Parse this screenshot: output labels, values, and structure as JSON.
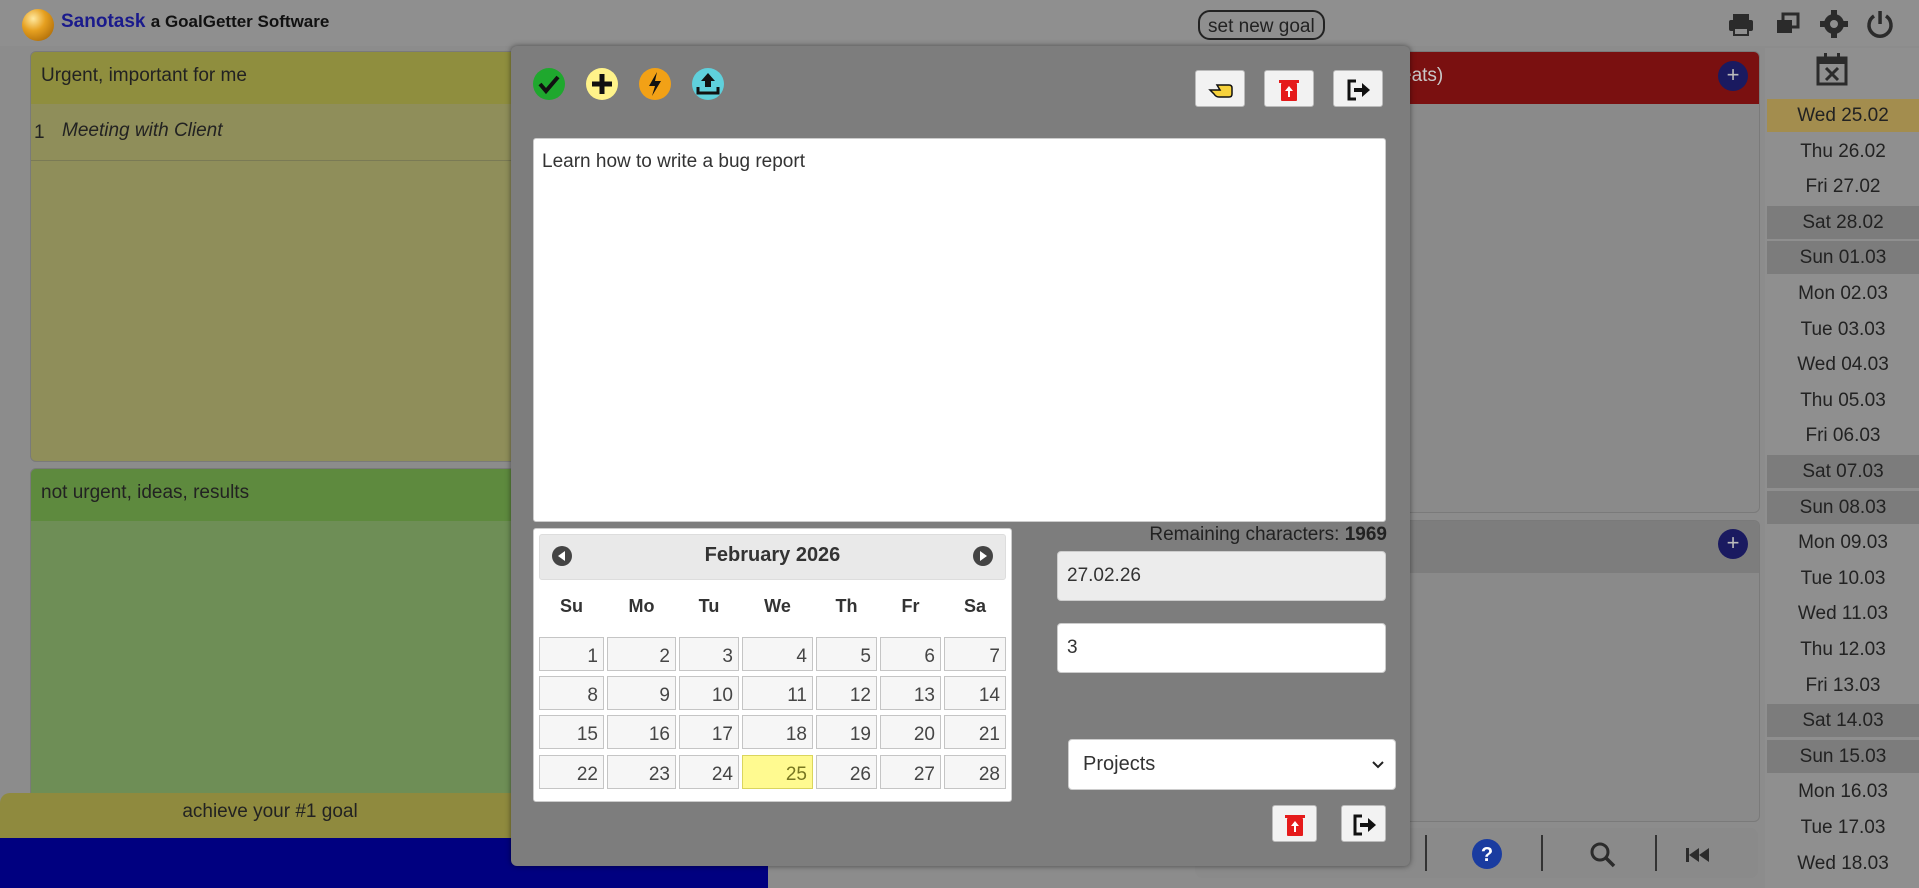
{
  "header": {
    "brand_name": "Sanotask",
    "brand_suffix": "a GoalGetter Software",
    "set_goal_label": "set new goal",
    "icons": [
      "print-icon",
      "windows-icon",
      "gear-icon",
      "power-icon"
    ]
  },
  "quadrants": {
    "urgent_important": {
      "title": "Urgent, important for me",
      "rows": [
        {
          "number": "1",
          "text": "Meeting with Client"
        }
      ]
    },
    "not_urgent": {
      "title": "not urgent, ideas, results"
    },
    "urgent_other": {
      "title_visible": "eats)"
    }
  },
  "bottom": {
    "goal_bar_label": "achieve your #1 goal"
  },
  "dates": [
    "Wed 25.02",
    "Thu 26.02",
    "Fri 27.02",
    "Sat 28.02",
    "Sun 01.03",
    "Mon 02.03",
    "Tue 03.03",
    "Wed 04.03",
    "Thu 05.03",
    "Fri 06.03",
    "Sat 07.03",
    "Sun 08.03",
    "Mon 09.03",
    "Tue 10.03",
    "Wed 11.03",
    "Thu 12.03",
    "Fri 13.03",
    "Sat 14.03",
    "Sun 15.03",
    "Mon 16.03",
    "Tue 17.03",
    "Wed 18.03"
  ],
  "modal": {
    "task_text": "Learn how to write a bug report",
    "remaining_label": "Remaining characters:",
    "remaining_count": "1969",
    "date_value": "27.02.26",
    "number_value": "3",
    "category_selected": "Projects",
    "calendar": {
      "month_title": "February 2026",
      "weekdays": [
        "Su",
        "Mo",
        "Tu",
        "We",
        "Th",
        "Fr",
        "Sa"
      ],
      "weeks": [
        [
          "1",
          "2",
          "3",
          "4",
          "5",
          "6",
          "7"
        ],
        [
          "8",
          "9",
          "10",
          "11",
          "12",
          "13",
          "14"
        ],
        [
          "15",
          "16",
          "17",
          "18",
          "19",
          "20",
          "21"
        ],
        [
          "22",
          "23",
          "24",
          "25",
          "26",
          "27",
          "28"
        ]
      ],
      "today": "25"
    }
  },
  "colors": {
    "brand_blue": "#1a1a8c",
    "today_highlight": "#fffa90",
    "urgent_red": "#7a1010",
    "bottom_blue": "#000080"
  }
}
